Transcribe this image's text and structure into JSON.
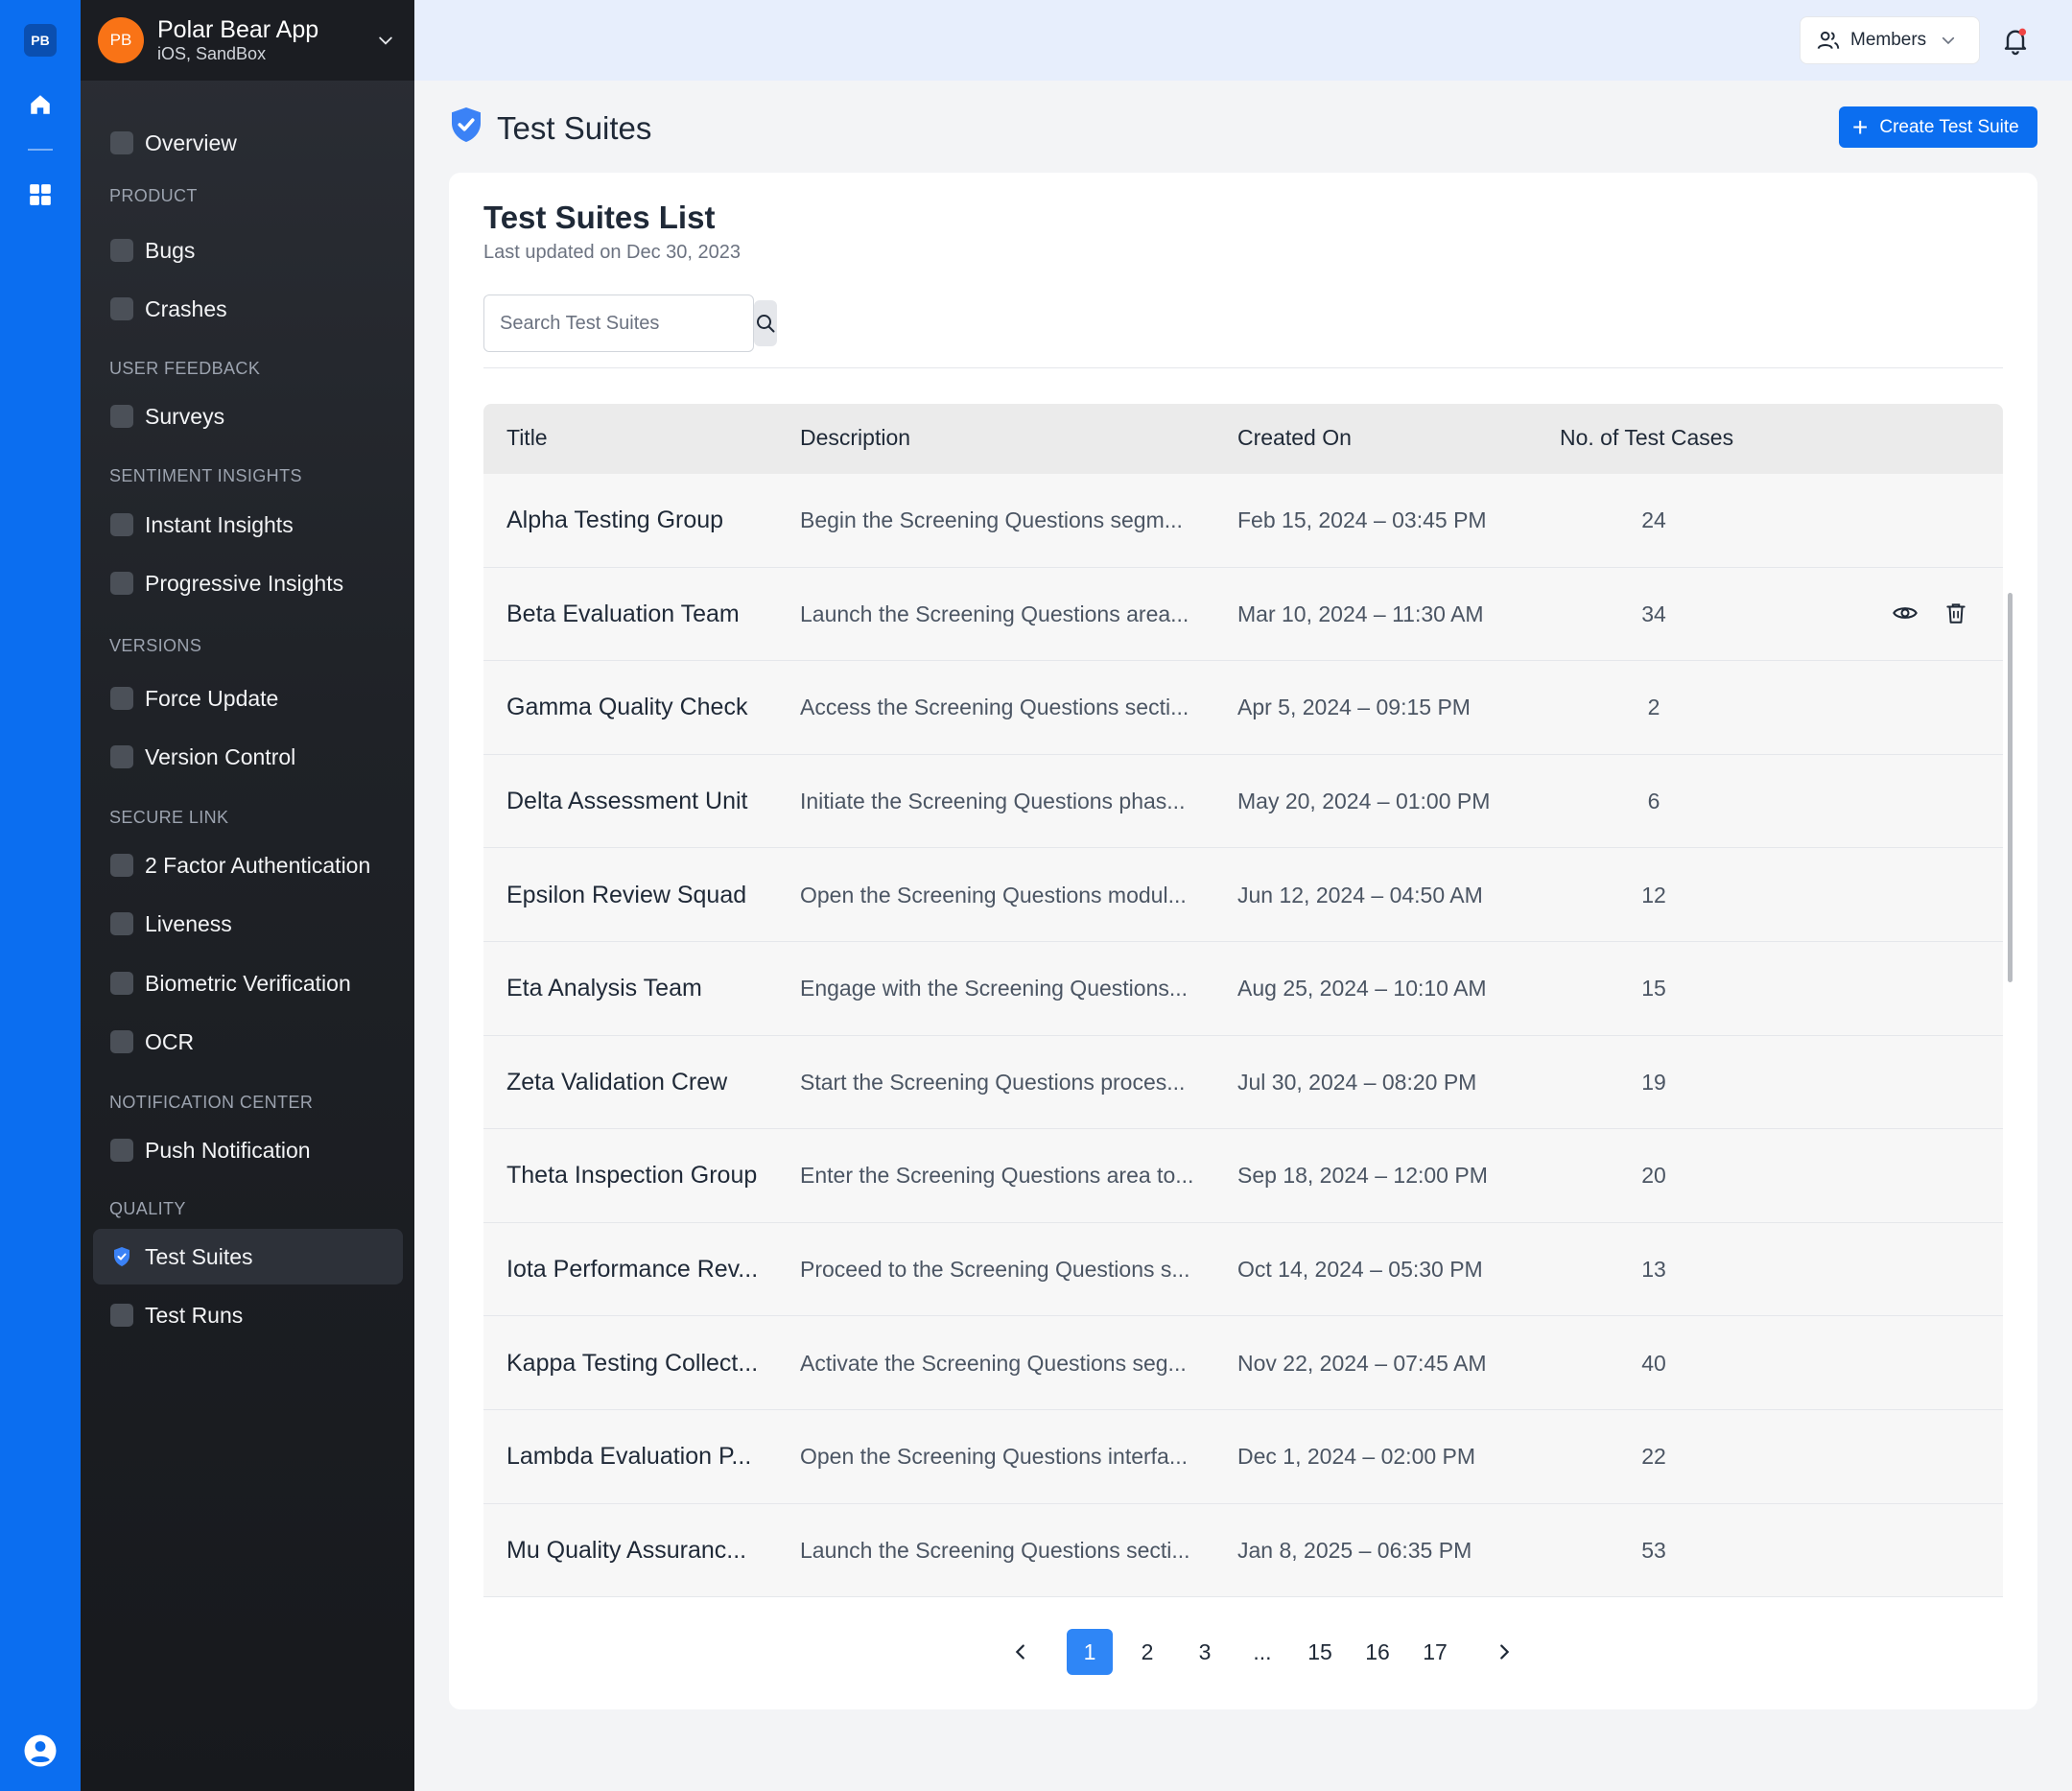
{
  "rail": {
    "logo": "PB",
    "icons": [
      "home-icon",
      "grid-icon",
      "user-circle-icon"
    ]
  },
  "app": {
    "avatar": "PB",
    "name": "Polar Bear App",
    "platform": "iOS, SandBox"
  },
  "sidebar": {
    "overview": "Overview",
    "sections": {
      "product": "PRODUCT",
      "user_feedback": "USER FEEDBACK",
      "sentiment": "SENTIMENT INSIGHTS",
      "versions": "VERSIONS",
      "secure_link": "SECURE LINK",
      "notification": "NOTIFICATION CENTER",
      "quality": "QUALITY"
    },
    "items": {
      "bugs": "Bugs",
      "crashes": "Crashes",
      "surveys": "Surveys",
      "instant": "Instant Insights",
      "progressive": "Progressive Insights",
      "force_update": "Force Update",
      "version_control": "Version Control",
      "two_factor": "2 Factor Authentication",
      "liveness": "Liveness",
      "biometric": "Biometric Verification",
      "ocr": "OCR",
      "push": "Push Notification",
      "test_suites": "Test Suites",
      "test_runs": "Test Runs"
    },
    "active": "test_suites"
  },
  "topbar": {
    "members_label": "Members",
    "notification_dot": true
  },
  "page": {
    "title": "Test Suites",
    "create_label": "Create Test Suite"
  },
  "card": {
    "title": "Test Suites List",
    "subtitle": "Last updated on Dec 30, 2023",
    "search_placeholder": "Search Test Suites",
    "search_value": ""
  },
  "table": {
    "columns": [
      "Title",
      "Description",
      "Created On",
      "No. of Test Cases"
    ],
    "rows": [
      {
        "title": "Alpha Testing Group",
        "description": "Begin the Screening Questions segm...",
        "created": "Feb 15, 2024 – 03:45 PM",
        "count": "24"
      },
      {
        "title": "Beta Evaluation Team",
        "description": "Launch the Screening Questions area...",
        "created": "Mar 10, 2024 – 11:30 AM",
        "count": "34"
      },
      {
        "title": "Gamma Quality Check",
        "description": "Access the Screening Questions secti...",
        "created": "Apr 5, 2024 – 09:15 PM",
        "count": "2"
      },
      {
        "title": "Delta Assessment Unit",
        "description": "Initiate the Screening Questions phas...",
        "created": "May 20, 2024 – 01:00 PM",
        "count": "6"
      },
      {
        "title": "Epsilon Review Squad",
        "description": "Open the Screening Questions modul...",
        "created": "Jun 12, 2024 – 04:50 AM",
        "count": "12"
      },
      {
        "title": "Eta Analysis Team",
        "description": "Engage with the Screening Questions...",
        "created": "Aug 25, 2024 – 10:10 AM",
        "count": "15"
      },
      {
        "title": "Zeta Validation Crew",
        "description": "Start the Screening Questions proces...",
        "created": "Jul 30, 2024 – 08:20 PM",
        "count": "19"
      },
      {
        "title": "Theta Inspection Group",
        "description": "Enter the Screening Questions area to...",
        "created": "Sep 18, 2024 – 12:00 PM",
        "count": "20"
      },
      {
        "title": "Iota Performance Rev...",
        "description": "Proceed to the Screening Questions s...",
        "created": "Oct 14, 2024 – 05:30 PM",
        "count": "13"
      },
      {
        "title": "Kappa Testing Collect...",
        "description": "Activate the Screening Questions seg...",
        "created": "Nov 22, 2024 – 07:45 AM",
        "count": "40"
      },
      {
        "title": "Lambda Evaluation P...",
        "description": "Open the Screening Questions interfa...",
        "created": "Dec 1, 2024 – 02:00 PM",
        "count": "22"
      },
      {
        "title": "Mu Quality Assuranc...",
        "description": "Launch the Screening Questions secti...",
        "created": "Jan 8, 2025 – 06:35 PM",
        "count": "53"
      }
    ],
    "hover_row_index": 1,
    "row_actions": [
      "eye-icon",
      "trash-icon"
    ]
  },
  "pagination": {
    "pages": [
      "1",
      "2",
      "3",
      "...",
      "15",
      "16",
      "17"
    ],
    "current": "1"
  },
  "colors": {
    "rail": "#0b6ef0",
    "accent": "#0b6ef0",
    "active_page": "#2f86f6",
    "app_avatar": "#f97316",
    "notification_dot": "#ef4444"
  }
}
